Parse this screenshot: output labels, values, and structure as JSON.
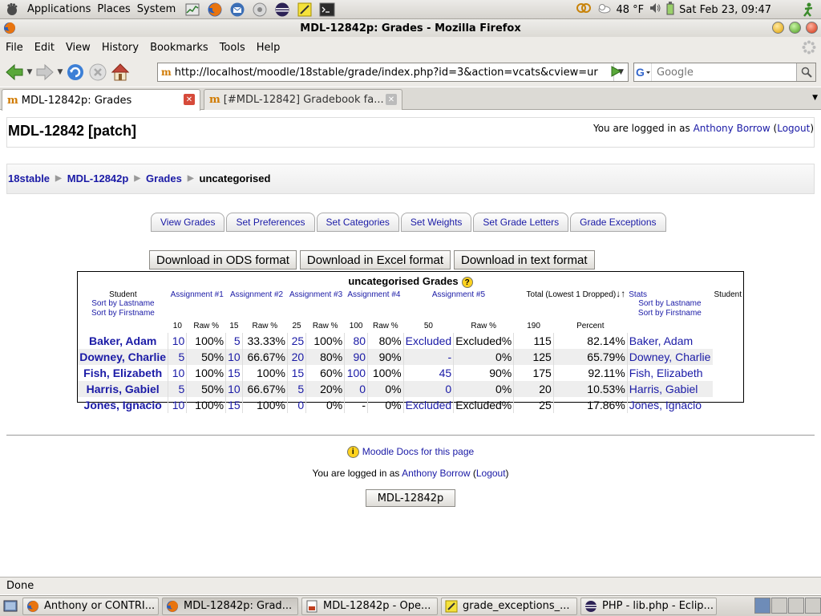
{
  "gnome_panel": {
    "menus": [
      "Applications",
      "Places",
      "System"
    ],
    "weather": "48 °F",
    "clock": "Sat Feb 23, 09:47"
  },
  "window": {
    "title": "MDL-12842p: Grades - Mozilla Firefox"
  },
  "menubar": [
    "File",
    "Edit",
    "View",
    "History",
    "Bookmarks",
    "Tools",
    "Help"
  ],
  "navigation": {
    "url": "http://localhost/moodle/18stable/grade/index.php?id=3&action=vcats&cview=ur",
    "search_placeholder": "Google"
  },
  "tabs": [
    {
      "label": "MDL-12842p: Grades",
      "active": true
    },
    {
      "label": "[#MDL-12842] Gradebook fa...",
      "active": false
    }
  ],
  "page": {
    "site_title": "MDL-12842 [patch]",
    "login_prefix": "You are logged in as",
    "user_name": "Anthony Borrow",
    "logout": "Logout",
    "breadcrumb": [
      "18stable",
      "MDL-12842p",
      "Grades",
      "uncategorised"
    ],
    "grade_tabs": [
      "View Grades",
      "Set Preferences",
      "Set Categories",
      "Set Weights",
      "Set Grade Letters",
      "Grade Exceptions"
    ],
    "download_buttons": [
      "Download in ODS format",
      "Download in Excel format",
      "Download in text format"
    ],
    "grades_title": "uncategorised Grades",
    "header": {
      "student": "Student",
      "sort_lastname": "Sort by Lastname",
      "sort_firstname": "Sort by Firstname",
      "assignments": [
        "Assignment #1",
        "Assignment #2",
        "Assignment #3",
        "Assignment #4",
        "Assignment #5"
      ],
      "total": "Total  (Lowest 1 Dropped)",
      "stats": "Stats",
      "max_points": [
        "10",
        "15",
        "25",
        "100",
        "50"
      ],
      "raw_percent": "Raw %",
      "total_max": "190",
      "percent": "Percent"
    },
    "rows": [
      {
        "name": "Baker, Adam",
        "name2": "Baker, Adam",
        "cells": [
          "10",
          "100%",
          "5",
          "33.33%",
          "25",
          "100%",
          "80",
          "80%",
          "Excluded",
          "Excluded%",
          "115",
          "82.14%"
        ]
      },
      {
        "name": "Downey, Charlie",
        "name2": "Downey, Charlie",
        "cells": [
          "5",
          "50%",
          "10",
          "66.67%",
          "20",
          "80%",
          "90",
          "90%",
          "-",
          "0%",
          "125",
          "65.79%"
        ]
      },
      {
        "name": "Fish, Elizabeth",
        "name2": "Fish, Elizabeth",
        "cells": [
          "10",
          "100%",
          "15",
          "100%",
          "15",
          "60%",
          "100",
          "100%",
          "45",
          "90%",
          "175",
          "92.11%"
        ]
      },
      {
        "name": "Harris, Gabiel",
        "name2": "Harris, Gabiel",
        "cells": [
          "5",
          "50%",
          "10",
          "66.67%",
          "5",
          "20%",
          "0",
          "0%",
          "0",
          "0%",
          "20",
          "10.53%"
        ]
      },
      {
        "name": "Jones, Ignacio",
        "name2": "Jones, Ignacio",
        "cells": [
          "10",
          "100%",
          "15",
          "100%",
          "0",
          "0%",
          "-",
          "0%",
          "Excluded",
          "Excluded%",
          "25",
          "17.86%"
        ]
      }
    ],
    "docs_link": "Moodle Docs for this page",
    "home_button": "MDL-12842p"
  },
  "statusbar": "Done",
  "taskbar": [
    {
      "label": "Anthony or CONTRI...",
      "active": false
    },
    {
      "label": "MDL-12842p: Grad...",
      "active": true
    },
    {
      "label": "MDL-12842p - Ope...",
      "active": false
    },
    {
      "label": "grade_exceptions_...",
      "active": false
    },
    {
      "label": "PHP - lib.php - Eclip...",
      "active": false
    }
  ]
}
